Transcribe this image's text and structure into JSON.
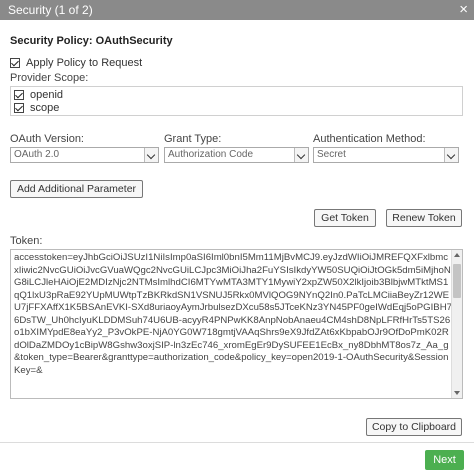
{
  "window": {
    "title": "Security (1 of 2)",
    "close_glyph": "×"
  },
  "policy": {
    "title": "Security Policy: OAuthSecurity"
  },
  "apply_policy": {
    "label": "Apply Policy to Request",
    "checked": true
  },
  "provider_scope": {
    "label": "Provider Scope:",
    "items": [
      {
        "label": "openid",
        "checked": true
      },
      {
        "label": "scope",
        "checked": true
      }
    ]
  },
  "oauth_version": {
    "label": "OAuth Version:",
    "value": "OAuth 2.0"
  },
  "grant_type": {
    "label": "Grant Type:",
    "value": "Authorization Code"
  },
  "auth_method": {
    "label": "Authentication Method:",
    "value": "Secret"
  },
  "buttons": {
    "add_param": "Add Additional Parameter",
    "get_token": "Get Token",
    "renew_token": "Renew Token",
    "copy": "Copy to Clipboard",
    "next": "Next"
  },
  "token": {
    "label": "Token:",
    "value": "accesstoken=eyJhbGciOiJSUzI1NiIsImp0aSI6Iml0bnI5Mm11MjBvMCJ9.eyJzdWIiOiJMREFQXFxlbmcxIiwic2NvcGUiOiJvcGVuaWQgc2NvcGUiLCJpc3MiOiJha2FuYSIsIkdyYW50SUQiOiJtOGk5dm5iMjhoNG8iLCJleHAiOjE2MDIzNjc2NTMsImlhdCI6MTYwMTA3MTY1MywiY2xpZW50X2lkIjoib3BlbjwMTktMS1qQ1lxU3pRaE92YUpMUWtpTzBKRkdSN1VSNUJ5Rkx0MVlQOG9NYnQ2In0.PaTcLMCiiaBeyZr12WEU7jFFXAffX1K5BSAnEVKI-SXd8uriaoyAymJrbulsezDXcu58s5JTceKNz3YN45PF0geIWdEqj5oPGIBH76DsTW_Uh0hcIyuKLDDMSuh74U6UB-acyyR4PNPwKK8AnpNobAnaeu4CM4shD8NpLFRfHrTs5TS26o1bXIMYpdE8eaYy2_P3vOkPE-NjA0YG0W718gmtjVAAqShrs9eX9JfdZAt6xKbpabOJr9OfDoPmK02RdOlDaZMDOy1cBipW8Gshw3oxjSIP-ln3zEc746_xromEgEr9DySUFEE1EcBx_ny8DbhMT8os7z_Aa_g&token_type=Bearer&granttype=authorization_code&policy_key=open2019-1-OAuthSecurity&SessionKey=&"
  }
}
